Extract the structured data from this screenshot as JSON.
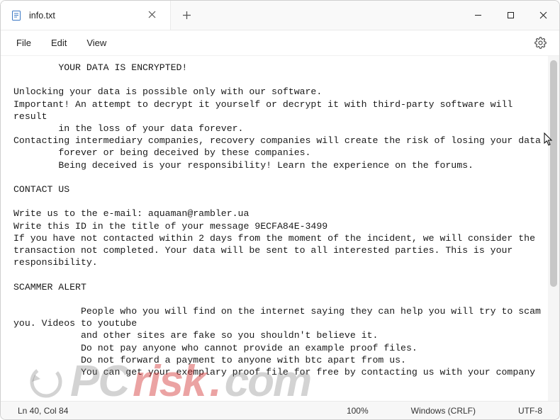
{
  "window": {
    "tab_title": "info.txt"
  },
  "menu": {
    "file": "File",
    "edit": "Edit",
    "view": "View"
  },
  "content": {
    "text": "        YOUR DATA IS ENCRYPTED!\n\nUnlocking your data is possible only with our software.\nImportant! An attempt to decrypt it yourself or decrypt it with third-party software will result\n        in the loss of your data forever.\nContacting intermediary companies, recovery companies will create the risk of losing your data\n        forever or being deceived by these companies.\n        Being deceived is your responsibility! Learn the experience on the forums.\n\nCONTACT US\n\nWrite us to the e-mail: aquaman@rambler.ua\nWrite this ID in the title of your message 9ECFA84E-3499\nIf you have not contacted within 2 days from the moment of the incident, we will consider the transaction not completed. Your data will be sent to all interested parties. This is your responsibility.\n\nSCAMMER ALERT\n\n            People who you will find on the internet saying they can help you will try to scam you. Videos to youtube\n            and other sites are fake so you shouldn't believe it.\n            Do not pay anyone who cannot provide an example proof files.\n            Do not forward a payment to anyone with btc apart from us.\n            You can get your exemplary proof file for free by contacting us with your company"
  },
  "status": {
    "position": "Ln 40, Col 84",
    "zoom": "100%",
    "line_ending": "Windows (CRLF)",
    "encoding": "UTF-8"
  },
  "watermark": {
    "pc": "PC",
    "risk": "risk",
    "com": "com"
  }
}
